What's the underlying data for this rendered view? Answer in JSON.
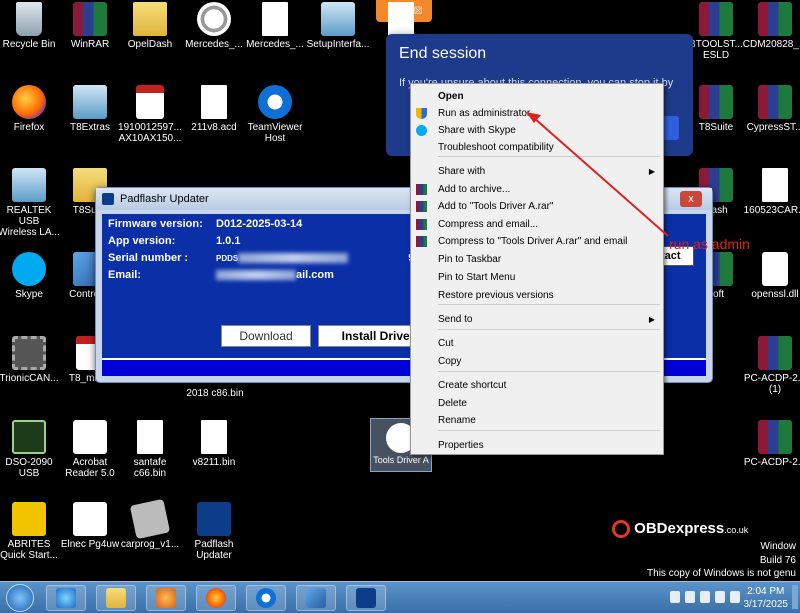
{
  "desktop": {
    "icons": [
      {
        "label": "Recycle Bin",
        "icon": "recycle-bin-icon"
      },
      {
        "label": "WinRAR",
        "icon": "winrar-icon"
      },
      {
        "label": "OpelDash",
        "icon": "folder-icon"
      },
      {
        "label": "Mercedes_...",
        "icon": "mercedes-icon"
      },
      {
        "label": "Mercedes_...",
        "icon": "file-icon"
      },
      {
        "label": "SetupInterfa...",
        "icon": "setup-icon"
      },
      {
        "label": "ec",
        "icon": "file-icon"
      },
      {
        "label": "BTOOLST...\nESLD",
        "icon": "winrar-icon"
      },
      {
        "label": "CDM20828_...",
        "icon": "winrar-icon"
      },
      {
        "label": "Firefox",
        "icon": "firefox-icon"
      },
      {
        "label": "T8Extras",
        "icon": "setup-icon"
      },
      {
        "label": "1910012597...\nAX10AX150...",
        "icon": "pdf-icon"
      },
      {
        "label": "211v8.acd",
        "icon": "file-icon"
      },
      {
        "label": "TeamViewer\nHost",
        "icon": "teamviewer-icon"
      },
      {
        "label": "T8Suite",
        "icon": "winrar-icon"
      },
      {
        "label": "CypressST...",
        "icon": "winrar-icon"
      },
      {
        "label": "REALTEK USB\nWireless LA...",
        "icon": "realtek-icon"
      },
      {
        "label": "T8Suite",
        "icon": "folder-icon"
      },
      {
        "label": "Dash",
        "icon": "winrar-icon"
      },
      {
        "label": "160523CAR...",
        "icon": "file-icon"
      },
      {
        "label": "Skype",
        "icon": "skype-icon"
      },
      {
        "label": "Control P",
        "icon": "control-panel-icon"
      },
      {
        "label": "soft",
        "icon": "winrar-icon"
      },
      {
        "label": "openssl.dll",
        "icon": "dll-icon"
      },
      {
        "label": "TrionicCAN...",
        "icon": "chip-icon"
      },
      {
        "label": "T8_manu",
        "icon": "pdf-icon"
      },
      {
        "label": "PC-ACDP-2...\n(1)",
        "icon": "winrar-icon"
      },
      {
        "label": "DSO-2090\nUSB",
        "icon": "oscilloscope-icon"
      },
      {
        "label": "Acrobat\nReader 5.0",
        "icon": "acrobat-icon"
      },
      {
        "label": "santafe\nc66.bin",
        "icon": "file-icon"
      },
      {
        "label": "v8211.bin",
        "icon": "file-icon"
      },
      {
        "label": "PC-ACDP-2...",
        "icon": "winrar-icon"
      },
      {
        "label": "ABRITES\nQuick Start...",
        "icon": "abrites-icon"
      },
      {
        "label": "Elnec Pg4uw",
        "icon": "elnec-icon"
      },
      {
        "label": "carprog_v1...",
        "icon": "carprog-icon"
      },
      {
        "label": "Padflash\nUpdater",
        "icon": "padflash-icon"
      }
    ],
    "hidden_label": "2018 c86.bin",
    "selected_icon_label": "Tools Driver A"
  },
  "updater": {
    "title": "Padflashr Updater",
    "firmware_label": "Firmware version:",
    "firmware_value": "D012-2025-03-14",
    "app_label": "App version:",
    "app_value": "1.0.1",
    "serial_label": "Serial number :",
    "serial_value": "PDDS",
    "serial_suffix": "9",
    "email_label": "Email:",
    "email_value": "ail.com",
    "download_label": "Download",
    "install_label": "Install Driver",
    "contact_label": "ontact",
    "close_symbol": "x"
  },
  "end_session": {
    "title": "End session",
    "message": "If you're unsure about this connection, you can stop it by",
    "stop_label": "t"
  },
  "context_menu": {
    "items": [
      {
        "label": "Open",
        "bold": true
      },
      {
        "label": "Run as administrator",
        "icon": "shield-icon"
      },
      {
        "label": "Share with Skype",
        "icon": "skype-icon"
      },
      {
        "label": "Troubleshoot compatibility"
      },
      {
        "label": "Share with",
        "submenu": true
      },
      {
        "label": "Add to archive...",
        "icon": "winrar-icon"
      },
      {
        "label": "Add to \"Tools Driver A.rar\"",
        "icon": "winrar-icon"
      },
      {
        "label": "Compress and email...",
        "icon": "winrar-icon"
      },
      {
        "label": "Compress to \"Tools Driver A.rar\" and email",
        "icon": "winrar-icon"
      },
      {
        "label": "Pin to Taskbar"
      },
      {
        "label": "Pin to Start Menu"
      },
      {
        "label": "Restore previous versions"
      },
      {
        "label": "Send to",
        "submenu": true
      },
      {
        "label": "Cut"
      },
      {
        "label": "Copy"
      },
      {
        "label": "Create shortcut"
      },
      {
        "label": "Delete"
      },
      {
        "label": "Rename"
      },
      {
        "label": "Properties"
      }
    ],
    "submenu_arrow": "▶"
  },
  "annotation": {
    "text": "run as admin",
    "color": "#e02020"
  },
  "watermark": {
    "brand": "OBDexpress",
    "domain": ".co.uk"
  },
  "windows_notice": {
    "line1": "Window",
    "line2": "Build 76",
    "line3": "This copy of Windows is not genu"
  },
  "taskbar": {
    "time": "2:04 PM",
    "date": "3/17/2025"
  }
}
